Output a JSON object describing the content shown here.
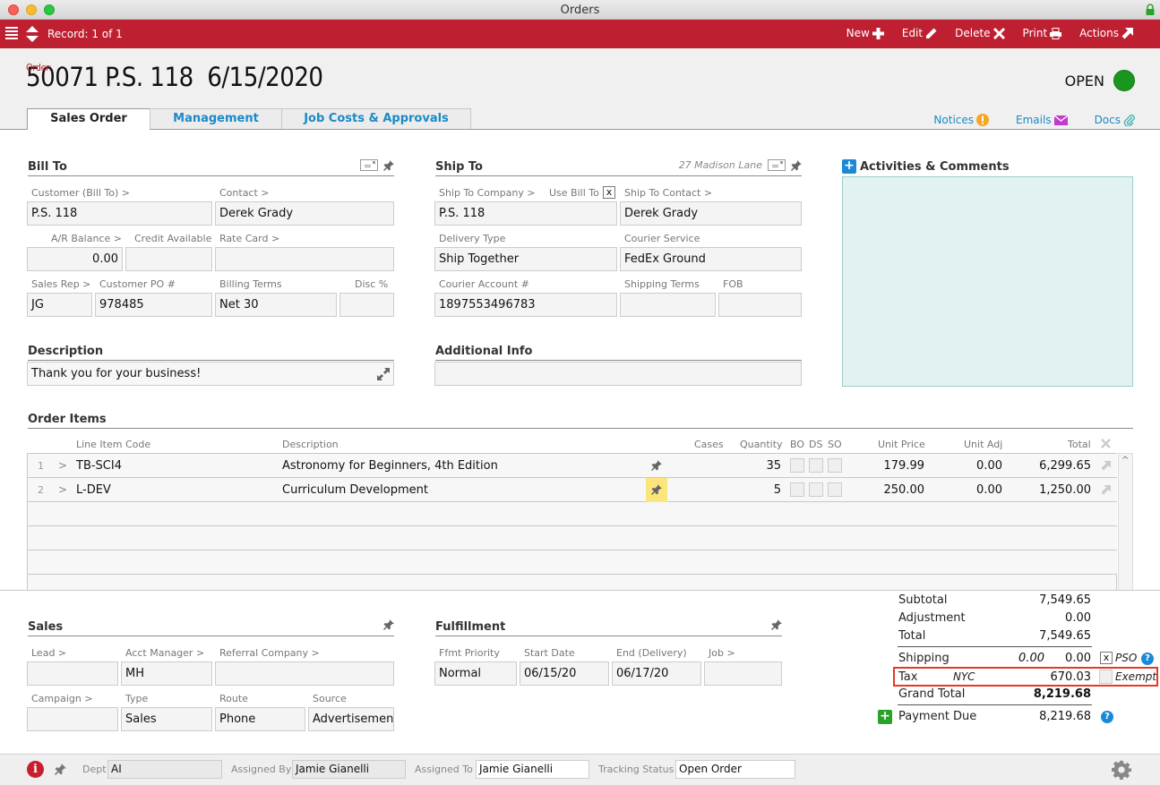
{
  "window": {
    "title": "Orders"
  },
  "toolbar": {
    "record": "Record: 1 of 1",
    "actions": [
      {
        "label": "New",
        "icon": "plus-icon"
      },
      {
        "label": "Edit",
        "icon": "pencil-icon"
      },
      {
        "label": "Delete",
        "icon": "x-icon"
      },
      {
        "label": "Print",
        "icon": "printer-icon"
      },
      {
        "label": "Actions",
        "icon": "arrow-out-icon"
      }
    ]
  },
  "header": {
    "order_label": "Order:",
    "order_value": "50071 P.S. 118  6/15/2020",
    "status": "OPEN",
    "status_color": "#1a961e",
    "tabs": [
      {
        "label": "Sales Order",
        "active": true
      },
      {
        "label": "Management",
        "active": false
      },
      {
        "label": "Job Costs & Approvals",
        "active": false
      }
    ],
    "links": [
      {
        "label": "Notices",
        "icon": "warning-icon"
      },
      {
        "label": "Emails",
        "icon": "envelope-icon"
      },
      {
        "label": "Docs",
        "icon": "paperclip-icon"
      }
    ]
  },
  "bill_to": {
    "title": "Bill To",
    "customer_label": "Customer (Bill To) >",
    "customer": "P.S. 118",
    "contact_label": "Contact >",
    "contact": "Derek Grady",
    "ar_balance_label": "A/R Balance >",
    "ar_balance": "0.00",
    "credit_label": "Credit Available",
    "credit": "",
    "rate_card_label": "Rate Card >",
    "rate_card": "",
    "sales_rep_label": "Sales Rep >",
    "sales_rep": "JG",
    "po_label": "Customer PO #",
    "po": "978485",
    "billing_terms_label": "Billing Terms",
    "billing_terms": "Net 30",
    "disc_label": "Disc %",
    "disc": ""
  },
  "ship_to": {
    "title": "Ship To",
    "address_note": "27 Madison Lane",
    "company_label": "Ship To Company >",
    "company": "P.S. 118",
    "use_bill_to_label": "Use Bill To",
    "use_bill_to_checked": "x",
    "contact_label": "Ship To Contact >",
    "contact": "Derek Grady",
    "delivery_type_label": "Delivery Type",
    "delivery_type": "Ship Together",
    "courier_service_label": "Courier Service",
    "courier_service": "FedEx Ground",
    "courier_account_label": "Courier Account #",
    "courier_account": "1897553496783",
    "shipping_terms_label": "Shipping Terms",
    "shipping_terms": "",
    "fob_label": "FOB",
    "fob": ""
  },
  "activities": {
    "title": "Activities & Comments"
  },
  "description": {
    "title": "Description",
    "value": "Thank you for your business!"
  },
  "additional_info": {
    "title": "Additional Info",
    "value": ""
  },
  "order_items": {
    "title": "Order Items",
    "columns": [
      "Line Item Code",
      "Description",
      "Cases",
      "Quantity",
      "BO",
      "DS",
      "SO",
      "Unit Price",
      "Unit Adj",
      "Total"
    ],
    "rows": [
      {
        "num": "1",
        "code": "TB-SCI4",
        "description": "Astronomy for Beginners, 4th Edition",
        "cases": "",
        "quantity": "35",
        "unit_price": "179.99",
        "unit_adj": "0.00",
        "total": "6,299.65",
        "pinned": false
      },
      {
        "num": "2",
        "code": "L-DEV",
        "description": "Curriculum Development",
        "cases": "",
        "quantity": "5",
        "unit_price": "250.00",
        "unit_adj": "0.00",
        "total": "1,250.00",
        "pinned": true
      }
    ]
  },
  "sales": {
    "title": "Sales",
    "lead_label": "Lead >",
    "lead": "",
    "acct_manager_label": "Acct Manager >",
    "acct_manager": "MH",
    "referral_label": "Referral Company >",
    "referral": "",
    "campaign_label": "Campaign >",
    "campaign": "",
    "type_label": "Type",
    "type": "Sales",
    "route_label": "Route",
    "route": "Phone",
    "source_label": "Source",
    "source": "Advertisemen"
  },
  "fulfillment": {
    "title": "Fulfillment",
    "priority_label": "Ffmt Priority",
    "priority": "Normal",
    "start_label": "Start Date",
    "start": "06/15/20",
    "end_label": "End (Delivery)",
    "end": "06/17/20",
    "job_label": "Job >",
    "job": ""
  },
  "totals": {
    "subtotal_label": "Subtotal",
    "subtotal": "7,549.65",
    "adjustment_label": "Adjustment",
    "adjustment": "0.00",
    "total_label": "Total",
    "total": "7,549.65",
    "shipping_label": "Shipping",
    "shipping_est": "0.00",
    "shipping": "0.00",
    "pso_checked": "x",
    "pso_label": "PSO",
    "tax_label": "Tax",
    "tax_region": "NYC",
    "tax": "670.03",
    "exempt_label": "Exempt",
    "grand_total_label": "Grand Total",
    "grand_total": "8,219.68",
    "payment_due_label": "Payment Due",
    "payment_due": "8,219.68"
  },
  "footer": {
    "dept_label": "Dept",
    "dept": "AI",
    "assigned_by_label": "Assigned By",
    "assigned_by": "Jamie Gianelli",
    "assigned_to_label": "Assigned To",
    "assigned_to": "Jamie Gianelli",
    "tracking_label": "Tracking Status",
    "tracking": "Open Order"
  }
}
